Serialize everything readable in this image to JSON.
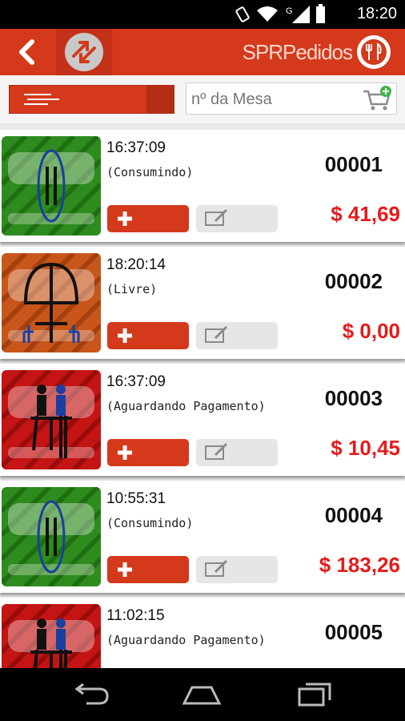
{
  "status_bar": {
    "time": "18:20",
    "network_label": "G"
  },
  "action_bar": {
    "title": "SPRPedidos"
  },
  "filter_bar": {
    "search_placeholder": "nº da Mesa"
  },
  "orders": [
    {
      "time": "16:37:09",
      "status": "(Consumindo)",
      "number": "00001",
      "total": "$ 41,69",
      "state": "consumindo",
      "color": "#2e8b1e"
    },
    {
      "time": "18:20:14",
      "status": "(Livre)",
      "number": "00002",
      "total": "$ 0,00",
      "state": "livre",
      "color": "#c8561a"
    },
    {
      "time": "16:37:09",
      "status": "(Aguardando Pagamento)",
      "number": "00003",
      "total": "$ 10,45",
      "state": "aguardando",
      "color": "#c41414"
    },
    {
      "time": "10:55:31",
      "status": "(Consumindo)",
      "number": "00004",
      "total": "$ 183,26",
      "state": "consumindo",
      "color": "#2e8b1e"
    },
    {
      "time": "11:02:15",
      "status": "(Aguardando Pagamento)",
      "number": "00005",
      "total": "",
      "state": "aguardando",
      "color": "#c41414"
    }
  ],
  "icons": {
    "back": "back-arrow-icon",
    "swap": "swap-arrows-icon",
    "logo": "fork-knife-icon",
    "menu": "menu-lines-icon",
    "cart": "cart-add-icon",
    "add": "plus-icon",
    "edit": "edit-note-icon"
  }
}
